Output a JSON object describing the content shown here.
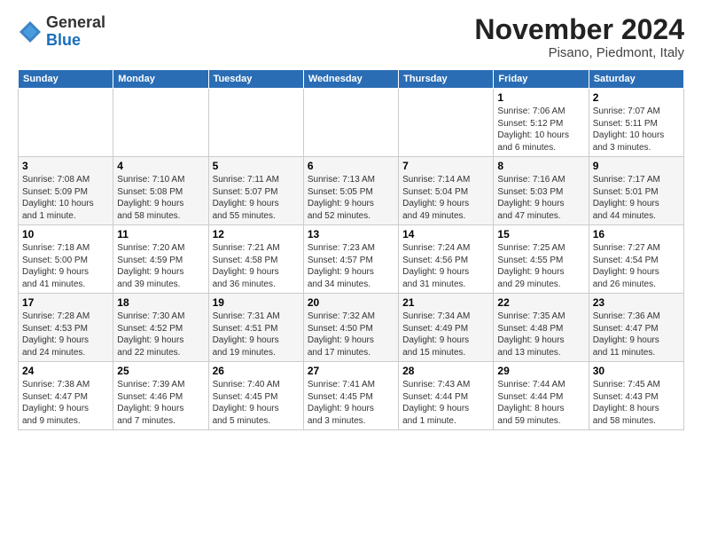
{
  "header": {
    "logo_general": "General",
    "logo_blue": "Blue",
    "month_title": "November 2024",
    "location": "Pisano, Piedmont, Italy"
  },
  "weekdays": [
    "Sunday",
    "Monday",
    "Tuesday",
    "Wednesday",
    "Thursday",
    "Friday",
    "Saturday"
  ],
  "weeks": [
    [
      {
        "day": "",
        "info": ""
      },
      {
        "day": "",
        "info": ""
      },
      {
        "day": "",
        "info": ""
      },
      {
        "day": "",
        "info": ""
      },
      {
        "day": "",
        "info": ""
      },
      {
        "day": "1",
        "info": "Sunrise: 7:06 AM\nSunset: 5:12 PM\nDaylight: 10 hours\nand 6 minutes."
      },
      {
        "day": "2",
        "info": "Sunrise: 7:07 AM\nSunset: 5:11 PM\nDaylight: 10 hours\nand 3 minutes."
      }
    ],
    [
      {
        "day": "3",
        "info": "Sunrise: 7:08 AM\nSunset: 5:09 PM\nDaylight: 10 hours\nand 1 minute."
      },
      {
        "day": "4",
        "info": "Sunrise: 7:10 AM\nSunset: 5:08 PM\nDaylight: 9 hours\nand 58 minutes."
      },
      {
        "day": "5",
        "info": "Sunrise: 7:11 AM\nSunset: 5:07 PM\nDaylight: 9 hours\nand 55 minutes."
      },
      {
        "day": "6",
        "info": "Sunrise: 7:13 AM\nSunset: 5:05 PM\nDaylight: 9 hours\nand 52 minutes."
      },
      {
        "day": "7",
        "info": "Sunrise: 7:14 AM\nSunset: 5:04 PM\nDaylight: 9 hours\nand 49 minutes."
      },
      {
        "day": "8",
        "info": "Sunrise: 7:16 AM\nSunset: 5:03 PM\nDaylight: 9 hours\nand 47 minutes."
      },
      {
        "day": "9",
        "info": "Sunrise: 7:17 AM\nSunset: 5:01 PM\nDaylight: 9 hours\nand 44 minutes."
      }
    ],
    [
      {
        "day": "10",
        "info": "Sunrise: 7:18 AM\nSunset: 5:00 PM\nDaylight: 9 hours\nand 41 minutes."
      },
      {
        "day": "11",
        "info": "Sunrise: 7:20 AM\nSunset: 4:59 PM\nDaylight: 9 hours\nand 39 minutes."
      },
      {
        "day": "12",
        "info": "Sunrise: 7:21 AM\nSunset: 4:58 PM\nDaylight: 9 hours\nand 36 minutes."
      },
      {
        "day": "13",
        "info": "Sunrise: 7:23 AM\nSunset: 4:57 PM\nDaylight: 9 hours\nand 34 minutes."
      },
      {
        "day": "14",
        "info": "Sunrise: 7:24 AM\nSunset: 4:56 PM\nDaylight: 9 hours\nand 31 minutes."
      },
      {
        "day": "15",
        "info": "Sunrise: 7:25 AM\nSunset: 4:55 PM\nDaylight: 9 hours\nand 29 minutes."
      },
      {
        "day": "16",
        "info": "Sunrise: 7:27 AM\nSunset: 4:54 PM\nDaylight: 9 hours\nand 26 minutes."
      }
    ],
    [
      {
        "day": "17",
        "info": "Sunrise: 7:28 AM\nSunset: 4:53 PM\nDaylight: 9 hours\nand 24 minutes."
      },
      {
        "day": "18",
        "info": "Sunrise: 7:30 AM\nSunset: 4:52 PM\nDaylight: 9 hours\nand 22 minutes."
      },
      {
        "day": "19",
        "info": "Sunrise: 7:31 AM\nSunset: 4:51 PM\nDaylight: 9 hours\nand 19 minutes."
      },
      {
        "day": "20",
        "info": "Sunrise: 7:32 AM\nSunset: 4:50 PM\nDaylight: 9 hours\nand 17 minutes."
      },
      {
        "day": "21",
        "info": "Sunrise: 7:34 AM\nSunset: 4:49 PM\nDaylight: 9 hours\nand 15 minutes."
      },
      {
        "day": "22",
        "info": "Sunrise: 7:35 AM\nSunset: 4:48 PM\nDaylight: 9 hours\nand 13 minutes."
      },
      {
        "day": "23",
        "info": "Sunrise: 7:36 AM\nSunset: 4:47 PM\nDaylight: 9 hours\nand 11 minutes."
      }
    ],
    [
      {
        "day": "24",
        "info": "Sunrise: 7:38 AM\nSunset: 4:47 PM\nDaylight: 9 hours\nand 9 minutes."
      },
      {
        "day": "25",
        "info": "Sunrise: 7:39 AM\nSunset: 4:46 PM\nDaylight: 9 hours\nand 7 minutes."
      },
      {
        "day": "26",
        "info": "Sunrise: 7:40 AM\nSunset: 4:45 PM\nDaylight: 9 hours\nand 5 minutes."
      },
      {
        "day": "27",
        "info": "Sunrise: 7:41 AM\nSunset: 4:45 PM\nDaylight: 9 hours\nand 3 minutes."
      },
      {
        "day": "28",
        "info": "Sunrise: 7:43 AM\nSunset: 4:44 PM\nDaylight: 9 hours\nand 1 minute."
      },
      {
        "day": "29",
        "info": "Sunrise: 7:44 AM\nSunset: 4:44 PM\nDaylight: 8 hours\nand 59 minutes."
      },
      {
        "day": "30",
        "info": "Sunrise: 7:45 AM\nSunset: 4:43 PM\nDaylight: 8 hours\nand 58 minutes."
      }
    ]
  ]
}
